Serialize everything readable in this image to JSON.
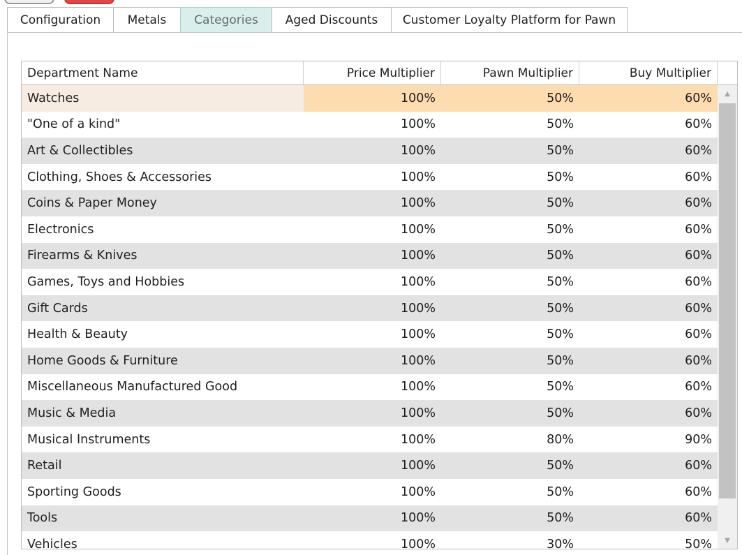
{
  "tabs": [
    {
      "label": "Configuration",
      "active": false
    },
    {
      "label": "Metals",
      "active": false
    },
    {
      "label": "Categories",
      "active": true
    },
    {
      "label": "Aged Discounts",
      "active": false
    },
    {
      "label": "Customer Loyalty Platform for Pawn",
      "active": false
    }
  ],
  "colors": {
    "active_tab_bg": "#d9efec",
    "row_alt_bg": "#e2e2e2",
    "selected_row_bg": "#f6ece2",
    "selected_cell_bg": "#fddcb0"
  },
  "table": {
    "columns": [
      "Department Name",
      "Price Multiplier",
      "Pawn Multiplier",
      "Buy Multiplier"
    ],
    "selected_index": 0,
    "rows": [
      {
        "name": "Watches",
        "price": "100%",
        "pawn": "50%",
        "buy": "60%"
      },
      {
        "name": "\"One of a kind\"",
        "price": "100%",
        "pawn": "50%",
        "buy": "60%"
      },
      {
        "name": "Art & Collectibles",
        "price": "100%",
        "pawn": "50%",
        "buy": "60%"
      },
      {
        "name": "Clothing, Shoes & Accessories",
        "price": "100%",
        "pawn": "50%",
        "buy": "60%"
      },
      {
        "name": "Coins & Paper Money",
        "price": "100%",
        "pawn": "50%",
        "buy": "60%"
      },
      {
        "name": "Electronics",
        "price": "100%",
        "pawn": "50%",
        "buy": "60%"
      },
      {
        "name": "Firearms & Knives",
        "price": "100%",
        "pawn": "50%",
        "buy": "60%"
      },
      {
        "name": "Games, Toys and Hobbies",
        "price": "100%",
        "pawn": "50%",
        "buy": "60%"
      },
      {
        "name": "Gift Cards",
        "price": "100%",
        "pawn": "50%",
        "buy": "60%"
      },
      {
        "name": "Health & Beauty",
        "price": "100%",
        "pawn": "50%",
        "buy": "60%"
      },
      {
        "name": "Home Goods & Furniture",
        "price": "100%",
        "pawn": "50%",
        "buy": "60%"
      },
      {
        "name": "Miscellaneous Manufactured Good",
        "price": "100%",
        "pawn": "50%",
        "buy": "60%"
      },
      {
        "name": "Music & Media",
        "price": "100%",
        "pawn": "50%",
        "buy": "60%"
      },
      {
        "name": "Musical Instruments",
        "price": "100%",
        "pawn": "80%",
        "buy": "90%"
      },
      {
        "name": "Retail",
        "price": "100%",
        "pawn": "50%",
        "buy": "60%"
      },
      {
        "name": "Sporting Goods",
        "price": "100%",
        "pawn": "50%",
        "buy": "60%"
      },
      {
        "name": "Tools",
        "price": "100%",
        "pawn": "50%",
        "buy": "60%"
      },
      {
        "name": "Vehicles",
        "price": "100%",
        "pawn": "30%",
        "buy": "50%"
      }
    ]
  },
  "scrollbar": {
    "up_icon": "scroll-up-arrow-icon",
    "down_icon": "scroll-down-arrow-icon"
  }
}
